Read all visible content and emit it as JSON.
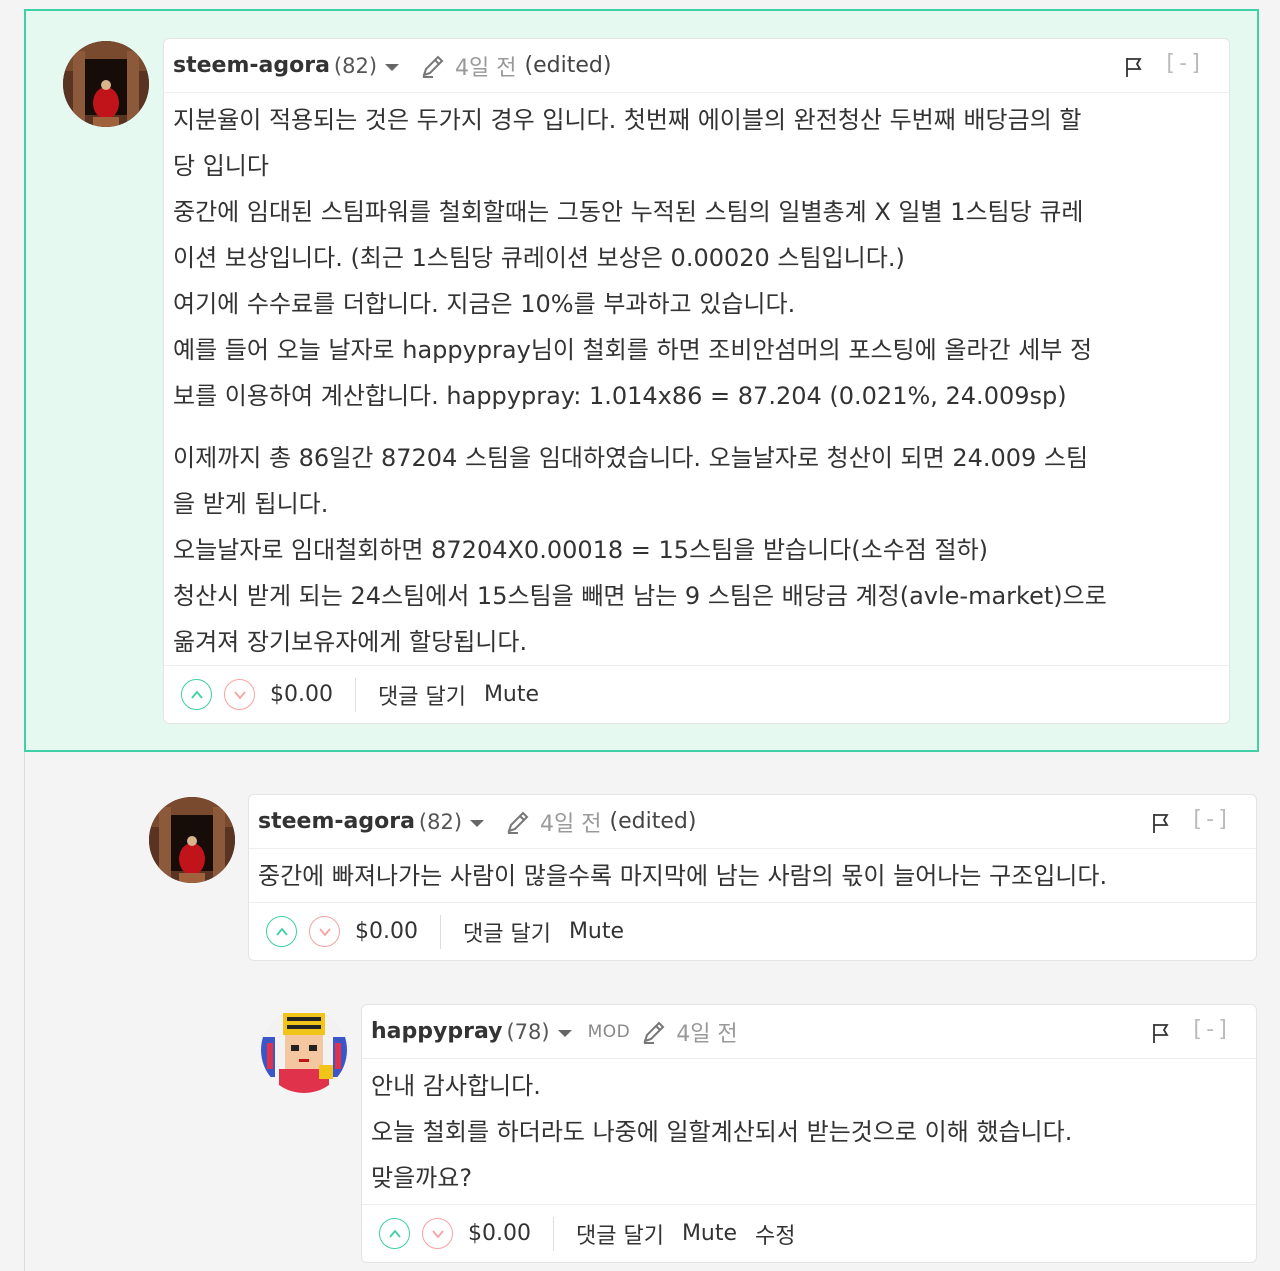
{
  "icons": {
    "caret": "chevron-down-icon",
    "edit": "pencil-icon",
    "flag": "flag-icon",
    "upvote": "chevron-up-circle-icon",
    "downvote": "chevron-down-circle-icon"
  },
  "colors": {
    "highlight_bg": "#e6f9f1",
    "highlight_border": "#3fd0a5",
    "upvote": "#3fd0a5",
    "downvote": "#f5a3a3"
  },
  "comments": [
    {
      "author": "steem-agora",
      "reputation": "(82)",
      "time": "4일 전",
      "edited": "(edited)",
      "collapse": "[-]",
      "body": [
        "지분율이 적용되는 것은 두가지 경우 입니다. 첫번째 에이블의 완전청산 두번째 배당금의 할",
        "당 입니다",
        "중간에 임대된 스팀파워를 철회할때는 그동안 누적된 스팀의 일별총계 X 일별 1스팀당 큐레",
        "이션 보상입니다. (최근 1스팀당 큐레이션 보상은 0.00020 스팀입니다.)",
        "여기에 수수료를 더합니다. 지금은 10%를 부과하고 있습니다.",
        "예를 들어 오늘 날자로 happypray님이 철회를 하면 조비안섬머의 포스팅에 올라간 세부 정",
        "보를 이용하여 계산합니다. happypray: 1.014x86 = 87.204 (0.021%, 24.009sp)",
        "이제까지 총 86일간 87204 스팀을 임대하였습니다. 오늘날자로 청산이 되면 24.009 스팀",
        "을 받게 됩니다.",
        "오늘날자로 임대철회하면 87204X0.00018 = 15스팀을 받습니다(소수점 절하)",
        "청산시 받게 되는 24스팀에서 15스팀을 빼면 남는 9 스팀은 배당금 계정(avle-market)으로",
        "옮겨져 장기보유자에게 할당됩니다."
      ],
      "payout": "$0.00",
      "reply_label": "댓글 달기",
      "mute_label": "Mute"
    },
    {
      "author": "steem-agora",
      "reputation": "(82)",
      "time": "4일 전",
      "edited": "(edited)",
      "collapse": "[-]",
      "body": [
        "중간에 빠져나가는 사람이 많을수록 마지막에 남는 사람의 몫이 늘어나는 구조입니다."
      ],
      "payout": "$0.00",
      "reply_label": "댓글 달기",
      "mute_label": "Mute"
    },
    {
      "author": "happypray",
      "reputation": "(78)",
      "mod_badge": "MOD",
      "time": "4일 전",
      "collapse": "[-]",
      "body": [
        "안내 감사합니다.",
        "오늘 철회를 하더라도 나중에 일할계산되서 받는것으로 이해 했습니다.",
        "맞을까요?"
      ],
      "payout": "$0.00",
      "reply_label": "댓글 달기",
      "mute_label": "Mute",
      "edit_label": "수정"
    }
  ]
}
